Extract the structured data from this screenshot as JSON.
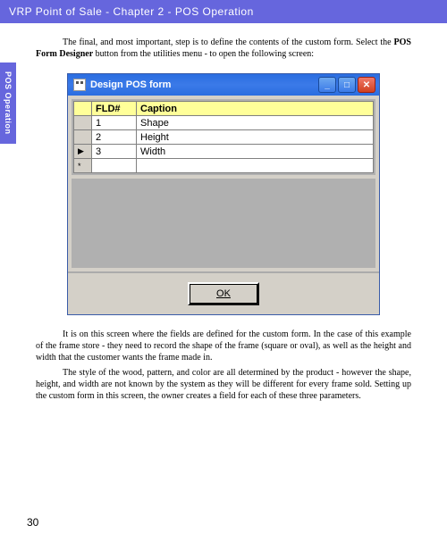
{
  "header": "VRP Point of Sale - Chapter 2 - POS Operation",
  "side_tab": "POS Operation",
  "intro": {
    "text_before": "The final, and most important, step is to define the contents of the custom form.  Select the ",
    "bold": "POS Form Designer",
    "text_after": " button from the utilities menu - to open the following screen:"
  },
  "window": {
    "title": "Design POS form",
    "columns": {
      "fld": "FLD#",
      "caption": "Caption"
    },
    "rows": [
      {
        "n": "1",
        "caption": "Shape"
      },
      {
        "n": "2",
        "caption": "Height"
      },
      {
        "n": "3",
        "caption": "Width"
      }
    ],
    "ok_label": "OK"
  },
  "para2": "It is on this screen where the fields are defined for the custom form.  In the case of this example of the frame store - they need to record the shape of the frame (square or oval), as well as the height and width that the customer wants the frame made in.",
  "para3": "The style of the wood, pattern, and color are all determined by the product - however the shape, height, and width are not known by the system as they will be different for every frame sold.  Setting up the custom form in this screen, the owner creates a field for each of these three parameters.",
  "page_number": "30"
}
